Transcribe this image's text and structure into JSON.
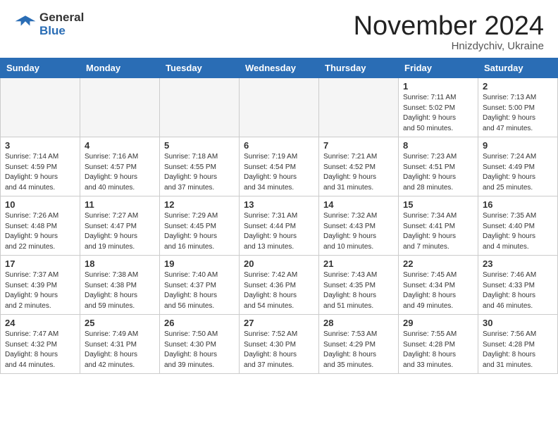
{
  "header": {
    "logo_general": "General",
    "logo_blue": "Blue",
    "month_title": "November 2024",
    "location": "Hnizdychiv, Ukraine"
  },
  "calendar": {
    "days_of_week": [
      "Sunday",
      "Monday",
      "Tuesday",
      "Wednesday",
      "Thursday",
      "Friday",
      "Saturday"
    ],
    "weeks": [
      [
        {
          "day": "",
          "info": "",
          "empty": true
        },
        {
          "day": "",
          "info": "",
          "empty": true
        },
        {
          "day": "",
          "info": "",
          "empty": true
        },
        {
          "day": "",
          "info": "",
          "empty": true
        },
        {
          "day": "",
          "info": "",
          "empty": true
        },
        {
          "day": "1",
          "info": "Sunrise: 7:11 AM\nSunset: 5:02 PM\nDaylight: 9 hours\nand 50 minutes."
        },
        {
          "day": "2",
          "info": "Sunrise: 7:13 AM\nSunset: 5:00 PM\nDaylight: 9 hours\nand 47 minutes."
        }
      ],
      [
        {
          "day": "3",
          "info": "Sunrise: 7:14 AM\nSunset: 4:59 PM\nDaylight: 9 hours\nand 44 minutes."
        },
        {
          "day": "4",
          "info": "Sunrise: 7:16 AM\nSunset: 4:57 PM\nDaylight: 9 hours\nand 40 minutes."
        },
        {
          "day": "5",
          "info": "Sunrise: 7:18 AM\nSunset: 4:55 PM\nDaylight: 9 hours\nand 37 minutes."
        },
        {
          "day": "6",
          "info": "Sunrise: 7:19 AM\nSunset: 4:54 PM\nDaylight: 9 hours\nand 34 minutes."
        },
        {
          "day": "7",
          "info": "Sunrise: 7:21 AM\nSunset: 4:52 PM\nDaylight: 9 hours\nand 31 minutes."
        },
        {
          "day": "8",
          "info": "Sunrise: 7:23 AM\nSunset: 4:51 PM\nDaylight: 9 hours\nand 28 minutes."
        },
        {
          "day": "9",
          "info": "Sunrise: 7:24 AM\nSunset: 4:49 PM\nDaylight: 9 hours\nand 25 minutes."
        }
      ],
      [
        {
          "day": "10",
          "info": "Sunrise: 7:26 AM\nSunset: 4:48 PM\nDaylight: 9 hours\nand 22 minutes."
        },
        {
          "day": "11",
          "info": "Sunrise: 7:27 AM\nSunset: 4:47 PM\nDaylight: 9 hours\nand 19 minutes."
        },
        {
          "day": "12",
          "info": "Sunrise: 7:29 AM\nSunset: 4:45 PM\nDaylight: 9 hours\nand 16 minutes."
        },
        {
          "day": "13",
          "info": "Sunrise: 7:31 AM\nSunset: 4:44 PM\nDaylight: 9 hours\nand 13 minutes."
        },
        {
          "day": "14",
          "info": "Sunrise: 7:32 AM\nSunset: 4:43 PM\nDaylight: 9 hours\nand 10 minutes."
        },
        {
          "day": "15",
          "info": "Sunrise: 7:34 AM\nSunset: 4:41 PM\nDaylight: 9 hours\nand 7 minutes."
        },
        {
          "day": "16",
          "info": "Sunrise: 7:35 AM\nSunset: 4:40 PM\nDaylight: 9 hours\nand 4 minutes."
        }
      ],
      [
        {
          "day": "17",
          "info": "Sunrise: 7:37 AM\nSunset: 4:39 PM\nDaylight: 9 hours\nand 2 minutes."
        },
        {
          "day": "18",
          "info": "Sunrise: 7:38 AM\nSunset: 4:38 PM\nDaylight: 8 hours\nand 59 minutes."
        },
        {
          "day": "19",
          "info": "Sunrise: 7:40 AM\nSunset: 4:37 PM\nDaylight: 8 hours\nand 56 minutes."
        },
        {
          "day": "20",
          "info": "Sunrise: 7:42 AM\nSunset: 4:36 PM\nDaylight: 8 hours\nand 54 minutes."
        },
        {
          "day": "21",
          "info": "Sunrise: 7:43 AM\nSunset: 4:35 PM\nDaylight: 8 hours\nand 51 minutes."
        },
        {
          "day": "22",
          "info": "Sunrise: 7:45 AM\nSunset: 4:34 PM\nDaylight: 8 hours\nand 49 minutes."
        },
        {
          "day": "23",
          "info": "Sunrise: 7:46 AM\nSunset: 4:33 PM\nDaylight: 8 hours\nand 46 minutes."
        }
      ],
      [
        {
          "day": "24",
          "info": "Sunrise: 7:47 AM\nSunset: 4:32 PM\nDaylight: 8 hours\nand 44 minutes."
        },
        {
          "day": "25",
          "info": "Sunrise: 7:49 AM\nSunset: 4:31 PM\nDaylight: 8 hours\nand 42 minutes."
        },
        {
          "day": "26",
          "info": "Sunrise: 7:50 AM\nSunset: 4:30 PM\nDaylight: 8 hours\nand 39 minutes."
        },
        {
          "day": "27",
          "info": "Sunrise: 7:52 AM\nSunset: 4:30 PM\nDaylight: 8 hours\nand 37 minutes."
        },
        {
          "day": "28",
          "info": "Sunrise: 7:53 AM\nSunset: 4:29 PM\nDaylight: 8 hours\nand 35 minutes."
        },
        {
          "day": "29",
          "info": "Sunrise: 7:55 AM\nSunset: 4:28 PM\nDaylight: 8 hours\nand 33 minutes."
        },
        {
          "day": "30",
          "info": "Sunrise: 7:56 AM\nSunset: 4:28 PM\nDaylight: 8 hours\nand 31 minutes."
        }
      ]
    ]
  }
}
